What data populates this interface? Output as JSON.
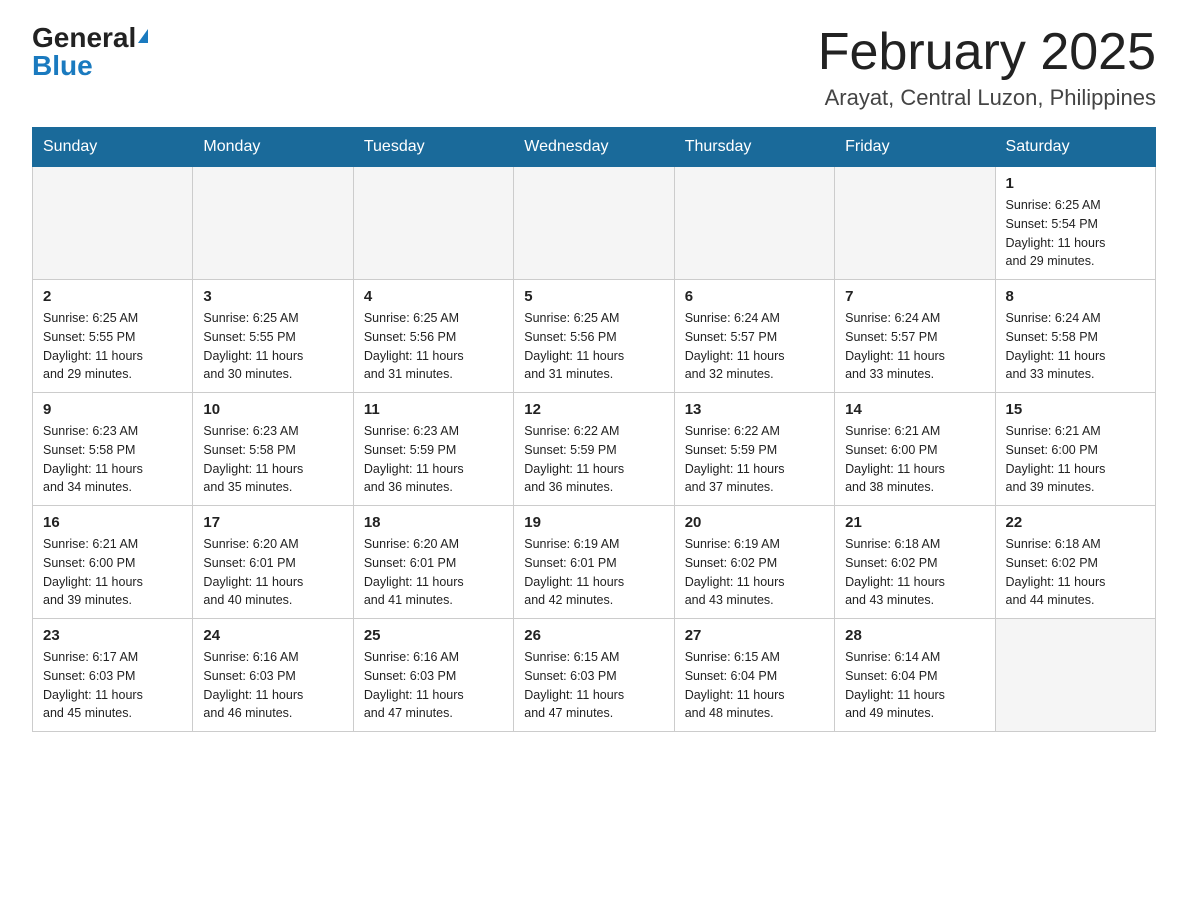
{
  "header": {
    "logo_general": "General",
    "logo_blue": "Blue",
    "month_title": "February 2025",
    "location": "Arayat, Central Luzon, Philippines"
  },
  "calendar": {
    "days_of_week": [
      "Sunday",
      "Monday",
      "Tuesday",
      "Wednesday",
      "Thursday",
      "Friday",
      "Saturday"
    ],
    "weeks": [
      {
        "days": [
          {
            "number": "",
            "info": ""
          },
          {
            "number": "",
            "info": ""
          },
          {
            "number": "",
            "info": ""
          },
          {
            "number": "",
            "info": ""
          },
          {
            "number": "",
            "info": ""
          },
          {
            "number": "",
            "info": ""
          },
          {
            "number": "1",
            "info": "Sunrise: 6:25 AM\nSunset: 5:54 PM\nDaylight: 11 hours\nand 29 minutes."
          }
        ]
      },
      {
        "days": [
          {
            "number": "2",
            "info": "Sunrise: 6:25 AM\nSunset: 5:55 PM\nDaylight: 11 hours\nand 29 minutes."
          },
          {
            "number": "3",
            "info": "Sunrise: 6:25 AM\nSunset: 5:55 PM\nDaylight: 11 hours\nand 30 minutes."
          },
          {
            "number": "4",
            "info": "Sunrise: 6:25 AM\nSunset: 5:56 PM\nDaylight: 11 hours\nand 31 minutes."
          },
          {
            "number": "5",
            "info": "Sunrise: 6:25 AM\nSunset: 5:56 PM\nDaylight: 11 hours\nand 31 minutes."
          },
          {
            "number": "6",
            "info": "Sunrise: 6:24 AM\nSunset: 5:57 PM\nDaylight: 11 hours\nand 32 minutes."
          },
          {
            "number": "7",
            "info": "Sunrise: 6:24 AM\nSunset: 5:57 PM\nDaylight: 11 hours\nand 33 minutes."
          },
          {
            "number": "8",
            "info": "Sunrise: 6:24 AM\nSunset: 5:58 PM\nDaylight: 11 hours\nand 33 minutes."
          }
        ]
      },
      {
        "days": [
          {
            "number": "9",
            "info": "Sunrise: 6:23 AM\nSunset: 5:58 PM\nDaylight: 11 hours\nand 34 minutes."
          },
          {
            "number": "10",
            "info": "Sunrise: 6:23 AM\nSunset: 5:58 PM\nDaylight: 11 hours\nand 35 minutes."
          },
          {
            "number": "11",
            "info": "Sunrise: 6:23 AM\nSunset: 5:59 PM\nDaylight: 11 hours\nand 36 minutes."
          },
          {
            "number": "12",
            "info": "Sunrise: 6:22 AM\nSunset: 5:59 PM\nDaylight: 11 hours\nand 36 minutes."
          },
          {
            "number": "13",
            "info": "Sunrise: 6:22 AM\nSunset: 5:59 PM\nDaylight: 11 hours\nand 37 minutes."
          },
          {
            "number": "14",
            "info": "Sunrise: 6:21 AM\nSunset: 6:00 PM\nDaylight: 11 hours\nand 38 minutes."
          },
          {
            "number": "15",
            "info": "Sunrise: 6:21 AM\nSunset: 6:00 PM\nDaylight: 11 hours\nand 39 minutes."
          }
        ]
      },
      {
        "days": [
          {
            "number": "16",
            "info": "Sunrise: 6:21 AM\nSunset: 6:00 PM\nDaylight: 11 hours\nand 39 minutes."
          },
          {
            "number": "17",
            "info": "Sunrise: 6:20 AM\nSunset: 6:01 PM\nDaylight: 11 hours\nand 40 minutes."
          },
          {
            "number": "18",
            "info": "Sunrise: 6:20 AM\nSunset: 6:01 PM\nDaylight: 11 hours\nand 41 minutes."
          },
          {
            "number": "19",
            "info": "Sunrise: 6:19 AM\nSunset: 6:01 PM\nDaylight: 11 hours\nand 42 minutes."
          },
          {
            "number": "20",
            "info": "Sunrise: 6:19 AM\nSunset: 6:02 PM\nDaylight: 11 hours\nand 43 minutes."
          },
          {
            "number": "21",
            "info": "Sunrise: 6:18 AM\nSunset: 6:02 PM\nDaylight: 11 hours\nand 43 minutes."
          },
          {
            "number": "22",
            "info": "Sunrise: 6:18 AM\nSunset: 6:02 PM\nDaylight: 11 hours\nand 44 minutes."
          }
        ]
      },
      {
        "days": [
          {
            "number": "23",
            "info": "Sunrise: 6:17 AM\nSunset: 6:03 PM\nDaylight: 11 hours\nand 45 minutes."
          },
          {
            "number": "24",
            "info": "Sunrise: 6:16 AM\nSunset: 6:03 PM\nDaylight: 11 hours\nand 46 minutes."
          },
          {
            "number": "25",
            "info": "Sunrise: 6:16 AM\nSunset: 6:03 PM\nDaylight: 11 hours\nand 47 minutes."
          },
          {
            "number": "26",
            "info": "Sunrise: 6:15 AM\nSunset: 6:03 PM\nDaylight: 11 hours\nand 47 minutes."
          },
          {
            "number": "27",
            "info": "Sunrise: 6:15 AM\nSunset: 6:04 PM\nDaylight: 11 hours\nand 48 minutes."
          },
          {
            "number": "28",
            "info": "Sunrise: 6:14 AM\nSunset: 6:04 PM\nDaylight: 11 hours\nand 49 minutes."
          },
          {
            "number": "",
            "info": ""
          }
        ]
      }
    ]
  }
}
